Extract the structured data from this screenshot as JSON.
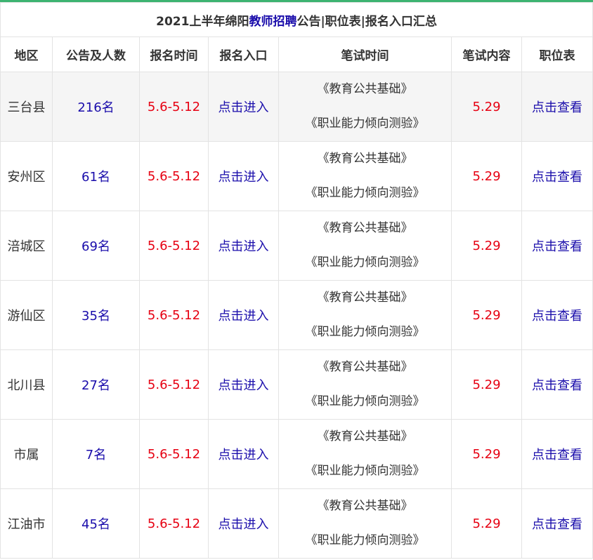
{
  "title": {
    "prefix": "2021上半年绵阳",
    "highlight": "教师招聘",
    "suffix": "公告|职位表|报名入口汇总"
  },
  "headers": [
    "地区",
    "公告及人数",
    "报名时间",
    "报名入口",
    "笔试时间",
    "笔试内容",
    "职位表"
  ],
  "rows": [
    {
      "region": "三台县",
      "count": "216名",
      "reg_time": "5.6-5.12",
      "entry": "点击进入",
      "exam_1": "《教育公共基础》",
      "exam_2": "《职业能力倾向测验》",
      "exam_date": "5.29",
      "positions": "点击查看"
    },
    {
      "region": "安州区",
      "count": "61名",
      "reg_time": "5.6-5.12",
      "entry": "点击进入",
      "exam_1": "《教育公共基础》",
      "exam_2": "《职业能力倾向测验》",
      "exam_date": "5.29",
      "positions": "点击查看"
    },
    {
      "region": "涪城区",
      "count": "69名",
      "reg_time": "5.6-5.12",
      "entry": "点击进入",
      "exam_1": "《教育公共基础》",
      "exam_2": "《职业能力倾向测验》",
      "exam_date": "5.29",
      "positions": "点击查看"
    },
    {
      "region": "游仙区",
      "count": "35名",
      "reg_time": "5.6-5.12",
      "entry": "点击进入",
      "exam_1": "《教育公共基础》",
      "exam_2": "《职业能力倾向测验》",
      "exam_date": "5.29",
      "positions": "点击查看"
    },
    {
      "region": "北川县",
      "count": "27名",
      "reg_time": "5.6-5.12",
      "entry": "点击进入",
      "exam_1": "《教育公共基础》",
      "exam_2": "《职业能力倾向测验》",
      "exam_date": "5.29",
      "positions": "点击查看"
    },
    {
      "region": "市属",
      "count": "7名",
      "reg_time": "5.6-5.12",
      "entry": "点击进入",
      "exam_1": "《教育公共基础》",
      "exam_2": "《职业能力倾向测验》",
      "exam_date": "5.29",
      "positions": "点击查看"
    },
    {
      "region": "江油市",
      "count": "45名",
      "reg_time": "5.6-5.12",
      "entry": "点击进入",
      "exam_1": "《教育公共基础》",
      "exam_2": "《职业能力倾向测验》",
      "exam_date": "5.29",
      "positions": "点击查看"
    }
  ],
  "colors": {
    "accent_line": "#3cb371",
    "link": "#1a0dab",
    "date": "#e60012",
    "shaded_row": "#f5f5f5"
  }
}
